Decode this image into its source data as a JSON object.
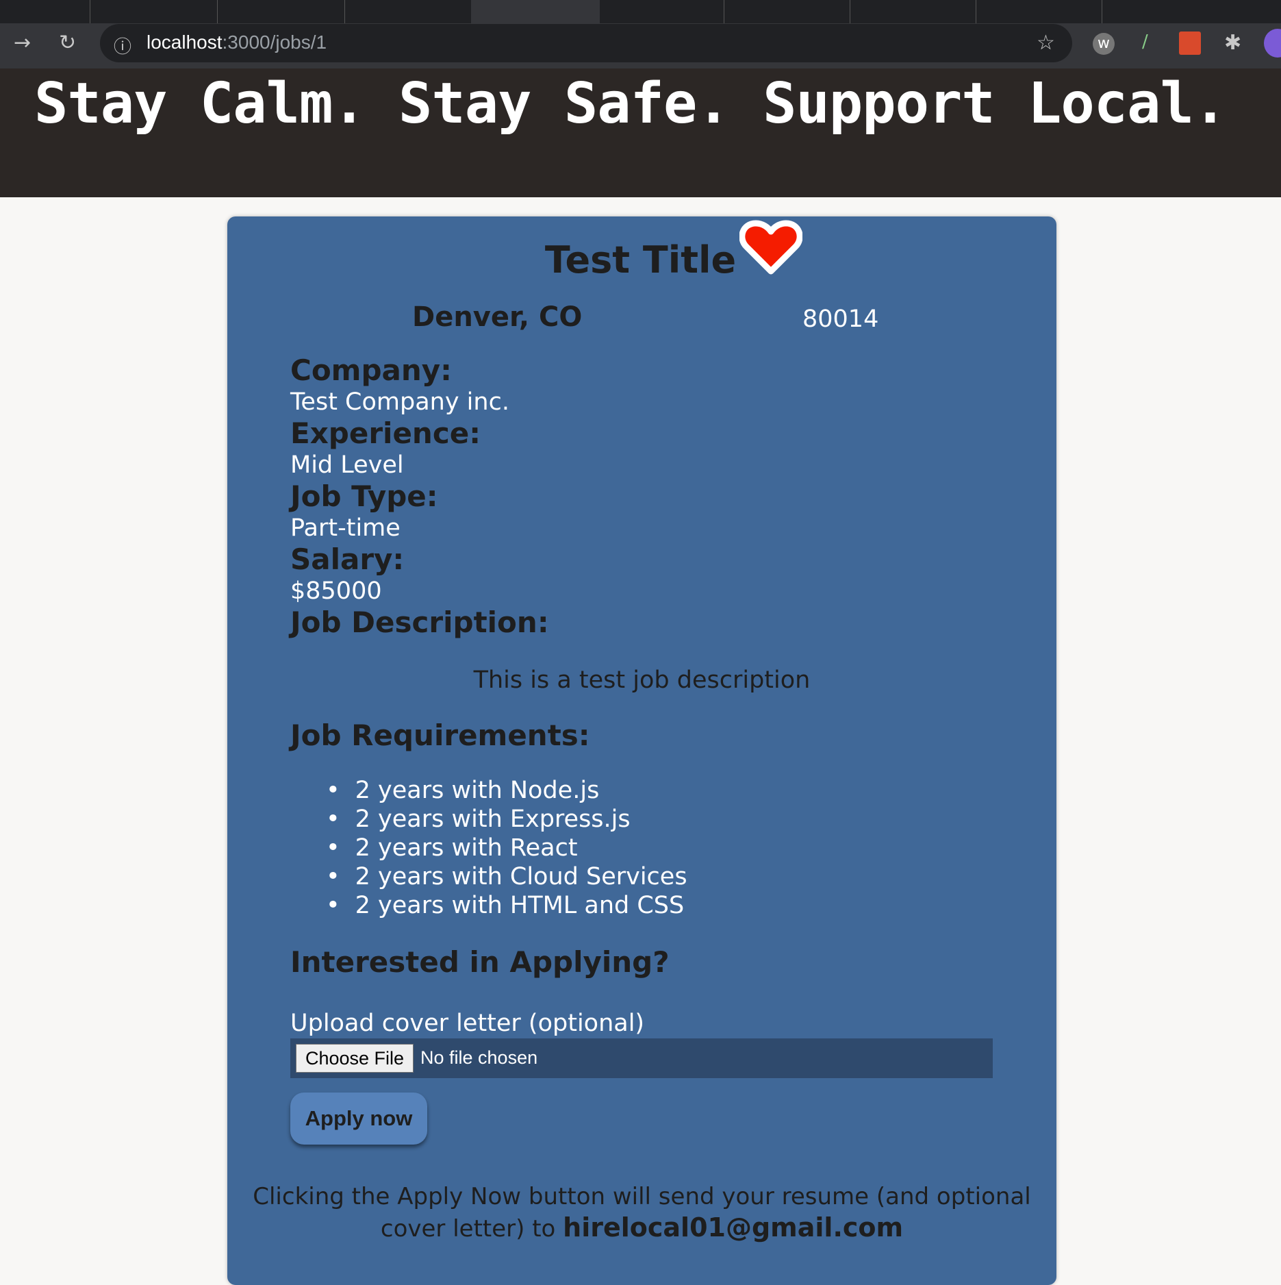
{
  "browser": {
    "url_host": "localhost",
    "url_rest": ":3000/jobs/1"
  },
  "banner": {
    "text": "Stay Calm. Stay Safe. Support Local."
  },
  "job": {
    "title": "Test Title",
    "location": "Denver, CO",
    "zip": "80014",
    "company_label": "Company:",
    "company": "Test Company inc.",
    "experience_label": "Experience:",
    "experience": "Mid Level",
    "type_label": "Job Type:",
    "type": "Part-time",
    "salary_label": "Salary:",
    "salary": "$85000",
    "description_label": "Job Description:",
    "description": "This is a test job description",
    "requirements_label": "Job Requirements:",
    "requirements": [
      "2 years with Node.js",
      "2 years with Express.js",
      "2 years with React",
      "2 years with Cloud Services",
      "2 years with HTML and CSS"
    ]
  },
  "apply": {
    "heading": "Interested in Applying?",
    "upload_label": "Upload cover letter (optional)",
    "choose_file": "Choose File",
    "no_file": "No file chosen",
    "button": "Apply now",
    "footer_text": "Clicking the Apply Now button will send your resume (and optional cover letter) to",
    "email": "hirelocal01@gmail.com"
  }
}
